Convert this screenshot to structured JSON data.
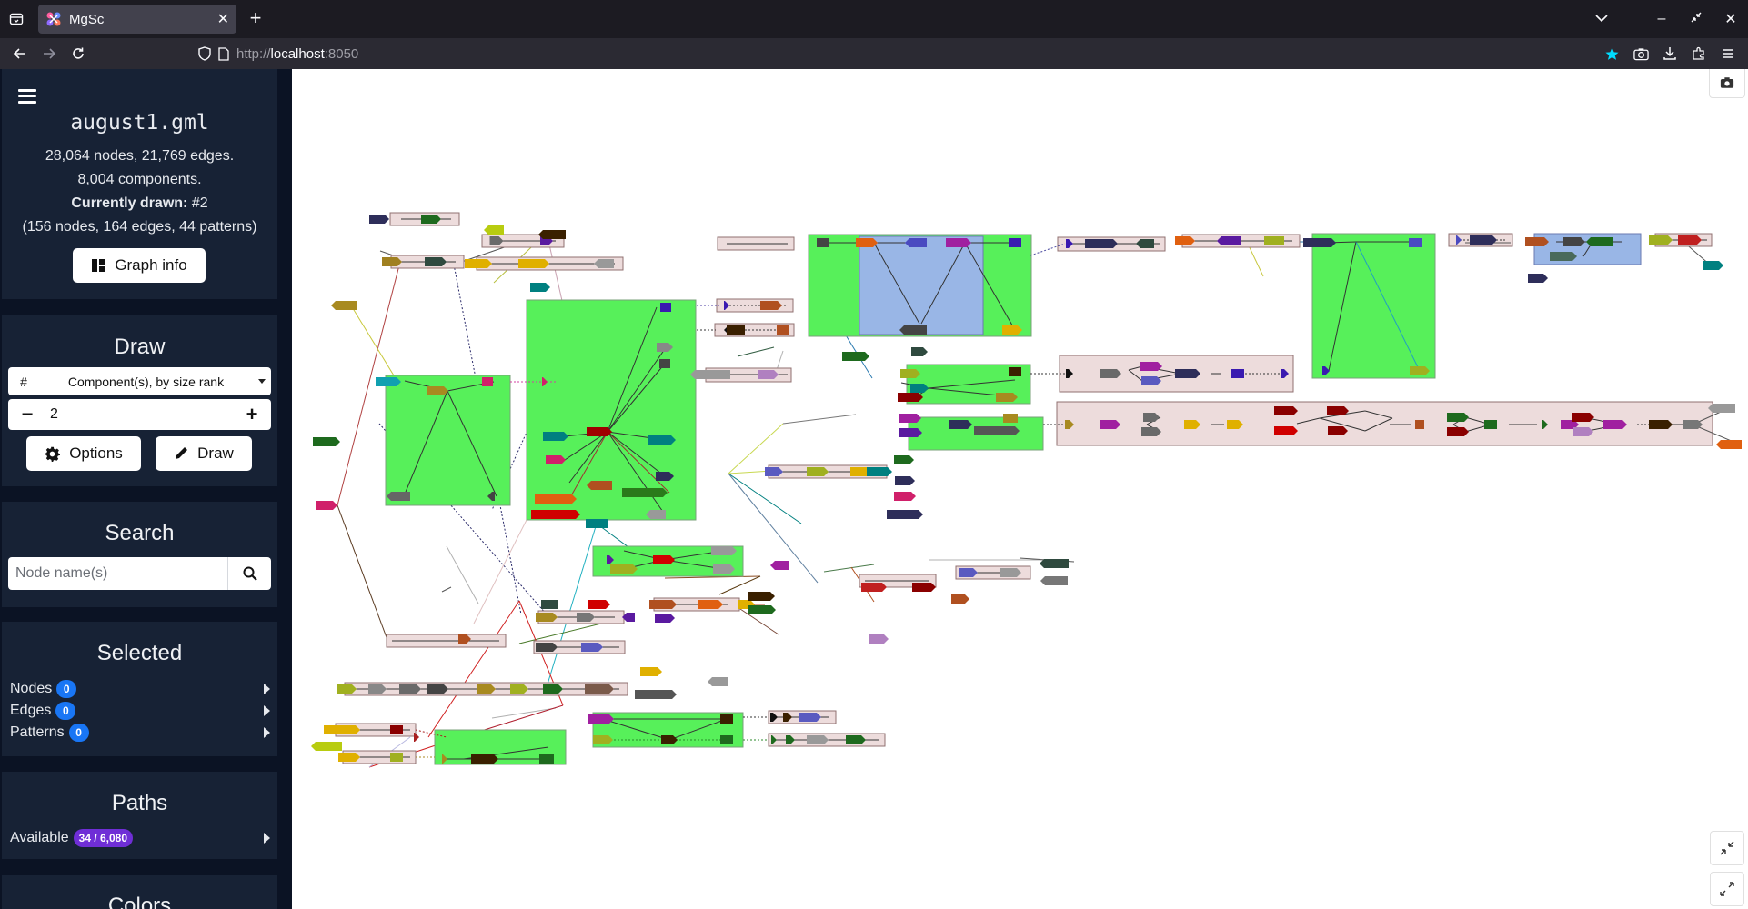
{
  "browser": {
    "tab_title": "MgSc",
    "url_scheme": "http://",
    "url_host": "localhost",
    "url_port": ":8050"
  },
  "sidebar": {
    "file_name": "august1.gml",
    "stats_line1": "28,064 nodes, 21,769 edges.",
    "stats_line2": "8,004 components.",
    "currently_drawn_label": "Currently drawn:",
    "currently_drawn_value": "#2",
    "stats_line4": "(156 nodes, 164 edges, 44 patterns)",
    "graph_info_label": "Graph info",
    "draw": {
      "title": "Draw",
      "select_hash": "#",
      "select_value": "Component(s), by size rank",
      "stepper_value": "2",
      "options_label": "Options",
      "draw_label": "Draw"
    },
    "search": {
      "title": "Search",
      "placeholder": "Node name(s)"
    },
    "selected": {
      "title": "Selected",
      "rows": [
        {
          "label": "Nodes",
          "count": "0"
        },
        {
          "label": "Edges",
          "count": "0"
        },
        {
          "label": "Patterns",
          "count": "0"
        }
      ]
    },
    "paths": {
      "title": "Paths",
      "available_label": "Available",
      "available_count": "34 / 6,080"
    },
    "colors": {
      "title": "Colors"
    }
  },
  "graph": {
    "colors": {
      "bubble_green": "#57f05a",
      "bubble_blue": "#99b6e6",
      "chain_pink": "#eddcdc"
    }
  }
}
